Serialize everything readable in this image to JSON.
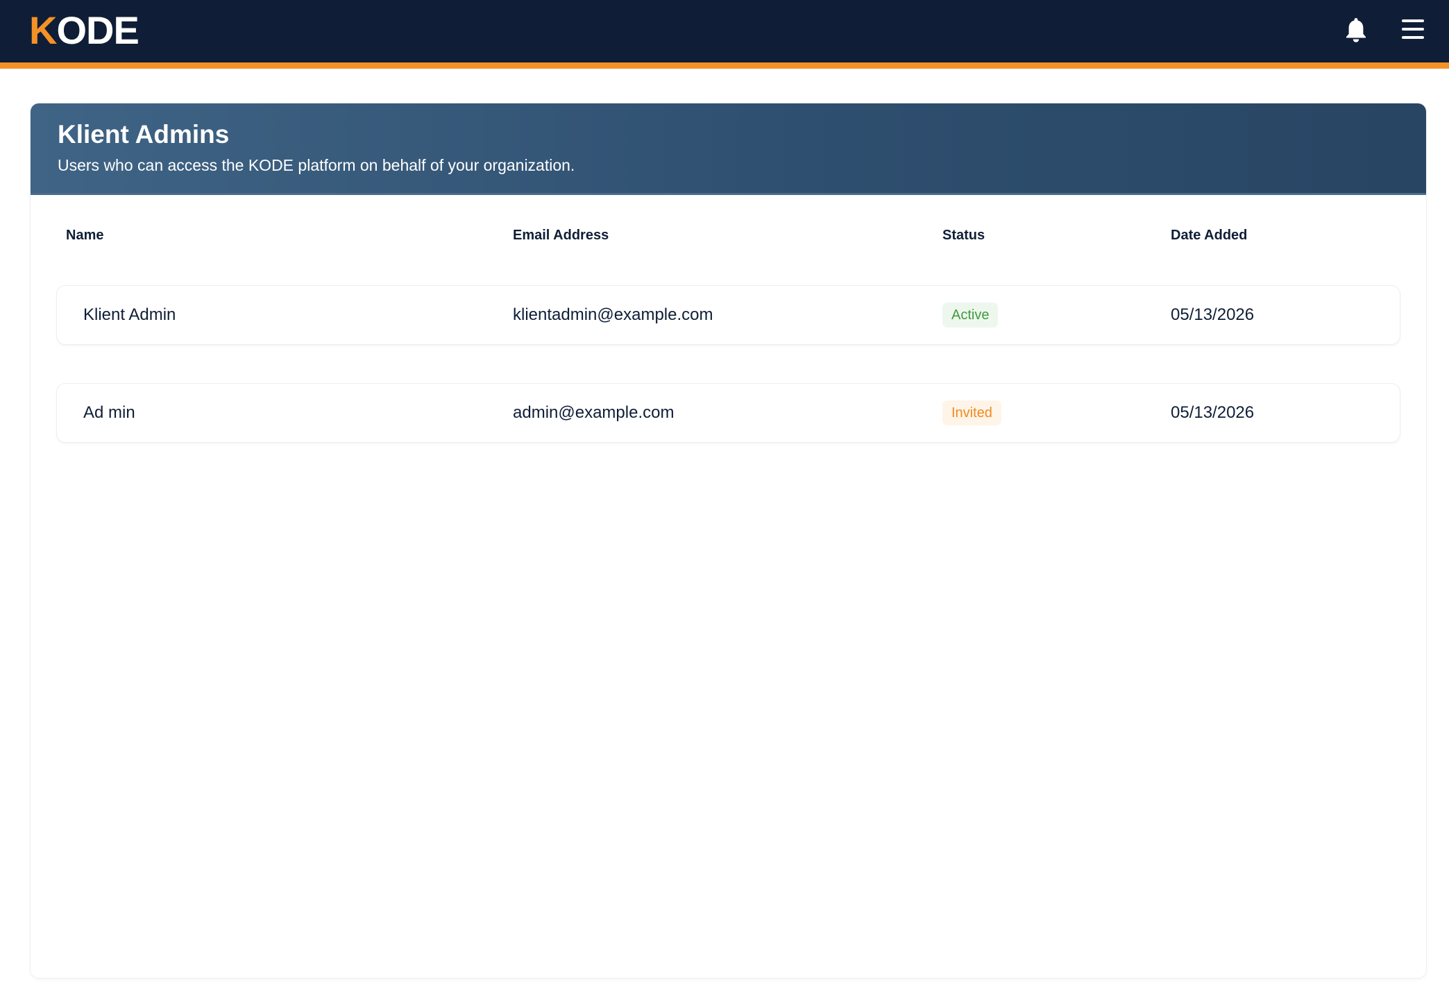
{
  "header": {
    "logo_first": "K",
    "logo_rest": "ODE",
    "notification_icon": "bell-icon",
    "menu_icon": "hamburger-menu-icon",
    "brand_color": "#0f1e36",
    "accent_color": "#f49227"
  },
  "panel": {
    "title": "Klient Admins",
    "subtitle": "Users who can access the KODE platform on behalf of your organization."
  },
  "table": {
    "columns": [
      "Name",
      "Email Address",
      "Status",
      "Date Added"
    ],
    "rows": [
      {
        "name": "Klient Admin",
        "email": "klientadmin@example.com",
        "status": "Active",
        "date_added": "05/13/2026"
      },
      {
        "name": "Ad min",
        "email": "admin@example.com",
        "status": "Invited",
        "date_added": "05/13/2026"
      }
    ]
  },
  "status_colors": {
    "Active": "#3f9a3f",
    "Invited": "#ef8a1e"
  }
}
